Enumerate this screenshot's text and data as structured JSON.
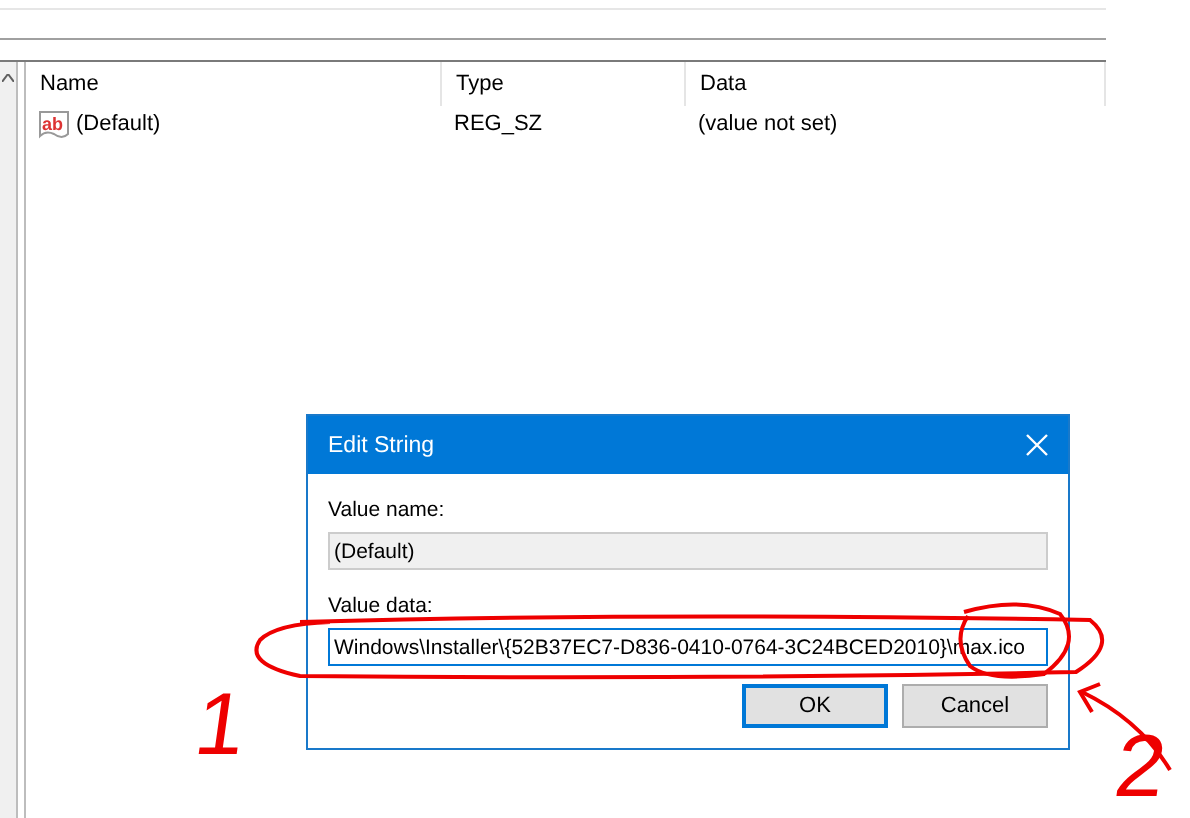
{
  "list": {
    "columns": [
      "Name",
      "Type",
      "Data"
    ],
    "rows": [
      {
        "icon": "ab",
        "name": "(Default)",
        "type": "REG_SZ",
        "data": "(value not set)"
      }
    ]
  },
  "dialog": {
    "title": "Edit String",
    "value_name_label": "Value name:",
    "value_name": "(Default)",
    "value_data_label": "Value data:",
    "value_data": "Windows\\Installer\\{52B37EC7-D836-0410-0764-3C24BCED2010}\\max.ico",
    "buttons": [
      {
        "label": "OK",
        "selected": true
      },
      {
        "label": "Cancel",
        "selected": false
      }
    ]
  },
  "annotations": [
    "1",
    "2"
  ]
}
